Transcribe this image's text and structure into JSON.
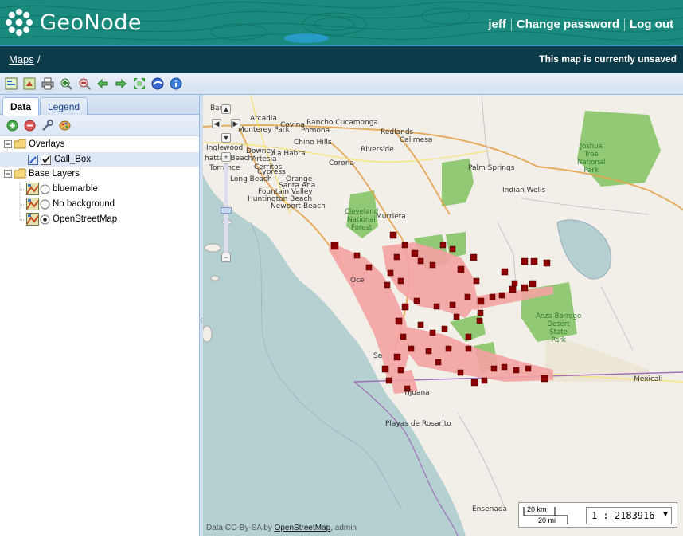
{
  "app": {
    "name": "GeoNode"
  },
  "user_nav": {
    "user": "jeff",
    "change_password": "Change password",
    "logout": "Log out"
  },
  "breadcrumb": {
    "maps": "Maps",
    "separator": "/",
    "status": "This map is currently unsaved"
  },
  "toolbar": {
    "icons": [
      "map-properties-icon",
      "export-map-icon",
      "print-icon",
      "zoom-in-icon",
      "zoom-out-icon",
      "back-icon",
      "forward-icon",
      "zoom-to-extent-icon",
      "google-earth-icon",
      "info-icon"
    ]
  },
  "panel": {
    "tabs": {
      "data": "Data",
      "legend": "Legend"
    },
    "tools": [
      "add-layer-icon",
      "remove-layer-icon",
      "layer-properties-icon",
      "styles-icon"
    ],
    "tree": {
      "overlays": "Overlays",
      "call_box": "Call_Box",
      "base_layers": "Base Layers",
      "bluemarble": "bluemarble",
      "no_background": "No background",
      "osm": "OpenStreetMap"
    }
  },
  "map": {
    "places": {
      "p0": "Bank",
      "p1": "Arcadia",
      "p2": "Monterey Park",
      "p3": "Covina",
      "p4": "Pomona",
      "p5": "Rancho Cucamonga",
      "p6": "Redlands",
      "p7": "Calimesa",
      "p8": "Chino Hills",
      "p9": "Inglewood",
      "p10": "Downey",
      "p11": "La Habra",
      "p12": "Riverside",
      "p13": "hattan Beach",
      "p14": "Artesia",
      "p15": "Cerritos",
      "p16": "Torrance",
      "p17": "Cypress",
      "p18": "Corona",
      "p19": "Palm Springs",
      "p20": "Long Beach",
      "p21": "Orange",
      "p22": "Santa Ana",
      "p23": "Fountain Valley",
      "p24": "Huntington Beach",
      "p25": "Newport Beach",
      "p26": "Indian Wells",
      "p27": "Murrieta",
      "p28": "Oce",
      "p29": "Sa",
      "p30": "Tijuana",
      "p31": "Playas de Rosarito",
      "p32": "Mexicali",
      "p33": "Ensenada"
    },
    "parks": {
      "joshua": "Joshua\nTree\nNational\nPark",
      "cleveland": "Cleveland\nNational\nForest",
      "anza": "Anza-Borrego\nDesert\nState\nPark"
    },
    "attribution": {
      "prefix": "Data CC-By-SA by",
      "link": "OpenStreetMap",
      "suffix": ", admin"
    },
    "scale": {
      "km": "20 km",
      "mi": "20 mi",
      "ratio": "1 : 2183916"
    },
    "colors": {
      "water": "#b5d0d0",
      "land": "#f2efe9",
      "park": "#8cc66e",
      "call_box": "#8b0000",
      "call_box_buffer": "#f4a3a3"
    }
  }
}
